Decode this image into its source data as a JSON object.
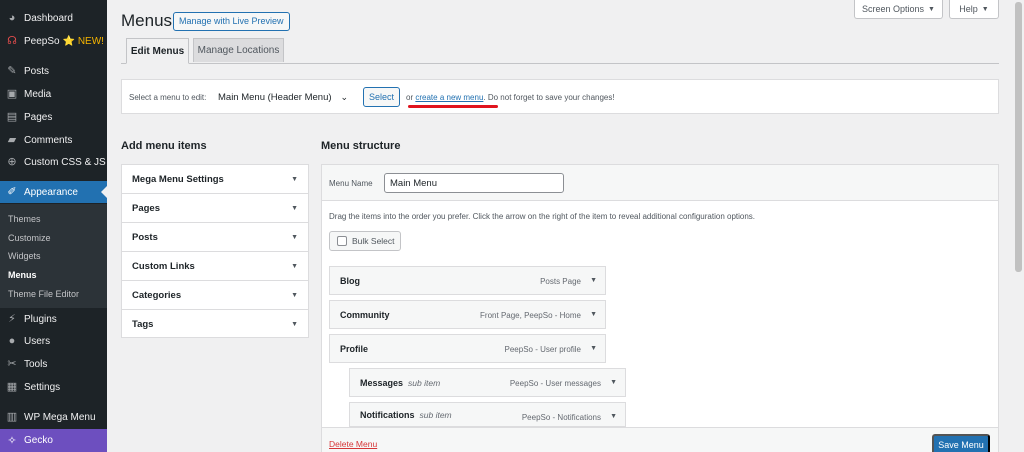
{
  "sidebar": {
    "items": [
      {
        "label": "Dashboard",
        "icon": "dashboard-icon",
        "glyph": "◕"
      },
      {
        "label": "PeepSo",
        "badge": "⭐ NEW!",
        "icon": "peepso-icon",
        "glyph": "☊"
      },
      {
        "label": "Posts",
        "icon": "pin-icon",
        "glyph": "✎"
      },
      {
        "label": "Media",
        "icon": "media-icon",
        "glyph": "▣"
      },
      {
        "label": "Pages",
        "icon": "pages-icon",
        "glyph": "▤"
      },
      {
        "label": "Comments",
        "icon": "comment-icon",
        "glyph": "▰"
      },
      {
        "label": "Custom CSS & JS",
        "icon": "plus-circle-icon",
        "glyph": "⊕"
      },
      {
        "label": "Appearance",
        "icon": "brush-icon",
        "glyph": "✐"
      },
      {
        "label": "Plugins",
        "icon": "plug-icon",
        "glyph": "⚡"
      },
      {
        "label": "Users",
        "icon": "user-icon",
        "glyph": "●"
      },
      {
        "label": "Tools",
        "icon": "wrench-icon",
        "glyph": "✂"
      },
      {
        "label": "Settings",
        "icon": "settings-icon",
        "glyph": "▦"
      },
      {
        "label": "WP Mega Menu",
        "icon": "mega-menu-icon",
        "glyph": "▥"
      },
      {
        "label": "Gecko",
        "icon": "gecko-icon",
        "glyph": "✧"
      }
    ],
    "submenu": [
      {
        "label": "Themes"
      },
      {
        "label": "Customize"
      },
      {
        "label": "Widgets"
      },
      {
        "label": "Menus"
      },
      {
        "label": "Theme File Editor"
      }
    ]
  },
  "header": {
    "title": "Menus",
    "live_preview_label": "Manage with Live Preview",
    "screen_options_label": "Screen Options",
    "help_label": "Help",
    "caret": "▼"
  },
  "tabs": [
    {
      "label": "Edit Menus"
    },
    {
      "label": "Manage Locations"
    }
  ],
  "select_bar": {
    "label": "Select a menu to edit:",
    "selected": "Main Menu (Header Menu)",
    "chevron": "⌄",
    "select_button": "Select",
    "or_text": "or",
    "create_link": "create a new menu",
    "suffix": ". Do not forget to save your changes!"
  },
  "add_items": {
    "title": "Add menu items",
    "sections": [
      {
        "label": "Mega Menu Settings"
      },
      {
        "label": "Pages"
      },
      {
        "label": "Posts"
      },
      {
        "label": "Custom Links"
      },
      {
        "label": "Categories"
      },
      {
        "label": "Tags"
      }
    ],
    "toggle": "▼"
  },
  "structure": {
    "title": "Menu structure",
    "menu_name_label": "Menu Name",
    "menu_name_value": "Main Menu",
    "instructions": "Drag the items into the order you prefer. Click the arrow on the right of the item to reveal additional configuration options.",
    "bulk_select_label": "Bulk Select",
    "items": [
      {
        "title": "Blog",
        "sub": "",
        "type": "Posts Page"
      },
      {
        "title": "Community",
        "sub": "",
        "type": "Front Page, PeepSo - Home"
      },
      {
        "title": "Profile",
        "sub": "",
        "type": "PeepSo - User profile"
      },
      {
        "title": "Messages",
        "sub": "sub item",
        "type": "PeepSo - User messages"
      },
      {
        "title": "Notifications",
        "sub": "sub item",
        "type": "PeepSo - Notifications"
      }
    ],
    "toggle": "▼",
    "delete_label": "Delete Menu",
    "save_label": "Save Menu"
  },
  "colors": {
    "sidebar_bg": "#1d2327",
    "accent": "#2271b1",
    "gecko": "#6d4fbf",
    "annotation": "#e0141e"
  }
}
